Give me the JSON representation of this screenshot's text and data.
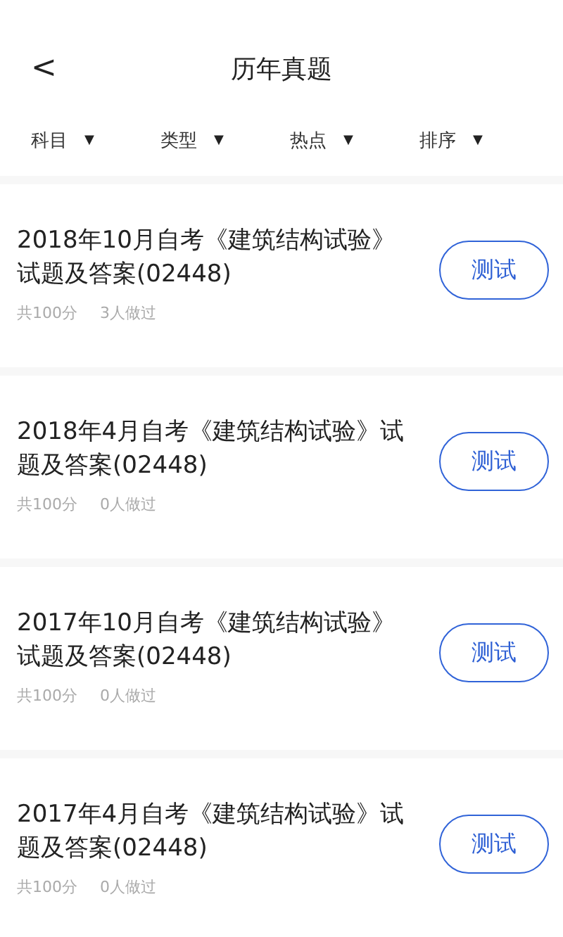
{
  "header": {
    "back": "<",
    "title": "历年真题"
  },
  "filters": [
    {
      "label": "科目",
      "caret": "▼"
    },
    {
      "label": "类型",
      "caret": "▼"
    },
    {
      "label": "热点",
      "caret": "▼"
    },
    {
      "label": "排序",
      "caret": "▼"
    }
  ],
  "papers": [
    {
      "title": "2018年10月自考《建筑结构试验》试题及答案(02448)",
      "score": "共100分",
      "takers": "3人做过",
      "button": "测试"
    },
    {
      "title": "2018年4月自考《建筑结构试验》试题及答案(02448)",
      "score": "共100分",
      "takers": "0人做过",
      "button": "测试"
    },
    {
      "title": "2017年10月自考《建筑结构试验》试题及答案(02448)",
      "score": "共100分",
      "takers": "0人做过",
      "button": "测试"
    },
    {
      "title": "2017年4月自考《建筑结构试验》试题及答案(02448)",
      "score": "共100分",
      "takers": "0人做过",
      "button": "测试"
    }
  ]
}
